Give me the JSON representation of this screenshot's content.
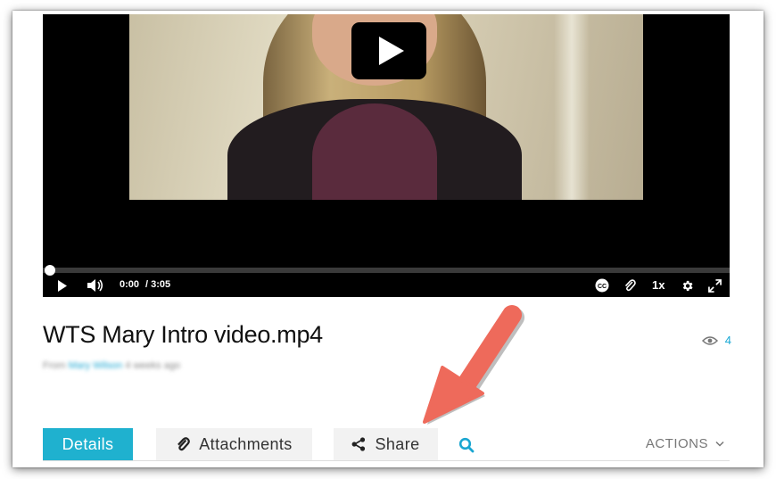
{
  "player": {
    "current_time": "0:00",
    "duration": "/ 3:05",
    "speed": "1x",
    "progress": 0,
    "icons": {
      "play_overlay": "play-icon",
      "play": "play-icon",
      "volume": "volume-icon",
      "captions": "closed-captions-icon",
      "attachment": "paperclip-icon",
      "settings": "gear-icon",
      "fullscreen": "fullscreen-icon"
    }
  },
  "media": {
    "title": "WTS Mary Intro video.mp4",
    "subtitle_prefix": "From",
    "subtitle_author": "Mary Wilson",
    "subtitle_suffix": "4 weeks ago",
    "views": "4"
  },
  "tabs": [
    {
      "label": "Details",
      "icon": null,
      "active": true
    },
    {
      "label": "Attachments",
      "icon": "paperclip-icon",
      "active": false
    },
    {
      "label": "Share",
      "icon": "share-icon",
      "active": false
    }
  ],
  "search_icon": "search-icon",
  "actions_label": "ACTIONS",
  "colors": {
    "accent": "#1fb1cf",
    "annotation_arrow": "#ee6a5b",
    "view_count": "#17a8d4"
  }
}
